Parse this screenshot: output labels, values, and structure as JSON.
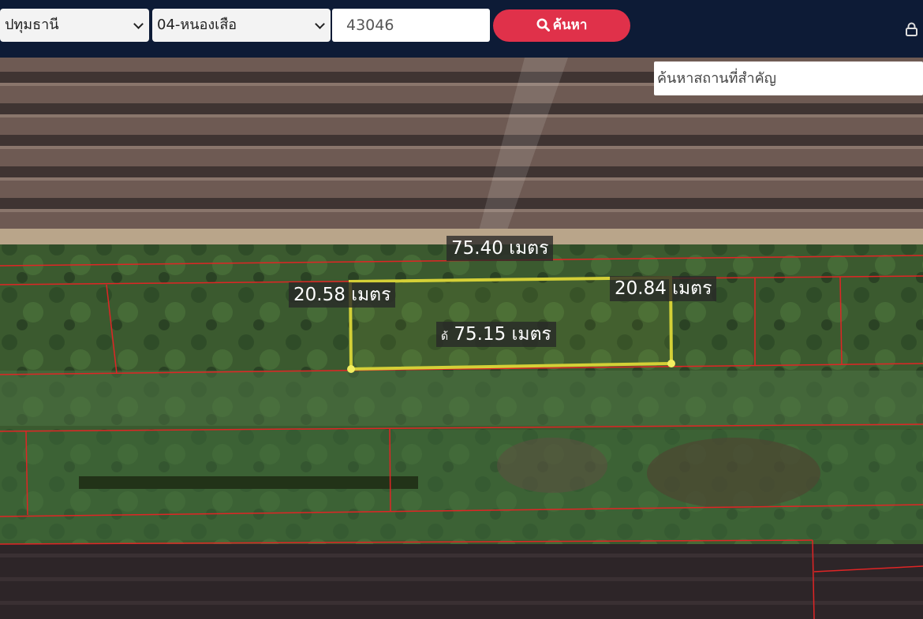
{
  "toolbar": {
    "province": "ปทุมธานี",
    "district": "04-หนองเสือ",
    "parcel_number": "43046",
    "search_label": "ค้นหา"
  },
  "map": {
    "place_search_placeholder": "ค้นหาสถานที่สำคัญ",
    "measurements": {
      "top": "75.40 เมตร",
      "left": "20.58 เมตร",
      "right": "20.84 เมตร",
      "bottom_prefix": "ด้",
      "bottom": "75.15 เมตร"
    },
    "colors": {
      "parcel_boundary": "#e02525",
      "selected_parcel": "#d4d037",
      "search_button": "#e0314a",
      "header": "#0d1b36"
    }
  }
}
